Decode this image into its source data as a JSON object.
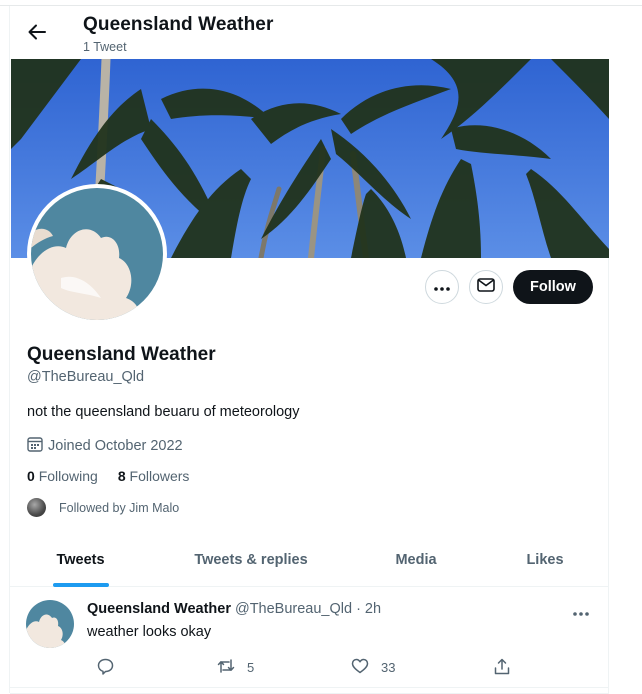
{
  "header": {
    "title": "Queensland Weather",
    "tweet_count": "1 Tweet"
  },
  "profile": {
    "name": "Queensland Weather",
    "handle": "@TheBureau_Qld",
    "bio": "not the queensland beuaru of meteorology",
    "joined": "Joined October 2022",
    "following_count": "0",
    "following_label": "Following",
    "followers_count": "8",
    "followers_label": "Followers",
    "followed_by": "Followed by Jim Malo",
    "follow_label": "Follow"
  },
  "tabs": [
    {
      "label": "Tweets",
      "active": true
    },
    {
      "label": "Tweets & replies",
      "active": false
    },
    {
      "label": "Media",
      "active": false
    },
    {
      "label": "Likes",
      "active": false
    }
  ],
  "tweet": {
    "name": "Queensland Weather",
    "handle": "@TheBureau_Qld",
    "separator": "·",
    "time": "2h",
    "text": "weather looks okay",
    "retweets": "5",
    "likes": "33"
  },
  "colors": {
    "accent": "#1d9bf0",
    "text": "#0f1419",
    "secondary": "#536471",
    "follow_button": "#0f1419"
  },
  "icons": [
    "back-arrow-icon",
    "more-icon",
    "mail-icon",
    "calendar-icon",
    "reply-icon",
    "retweet-icon",
    "like-icon",
    "share-icon"
  ]
}
